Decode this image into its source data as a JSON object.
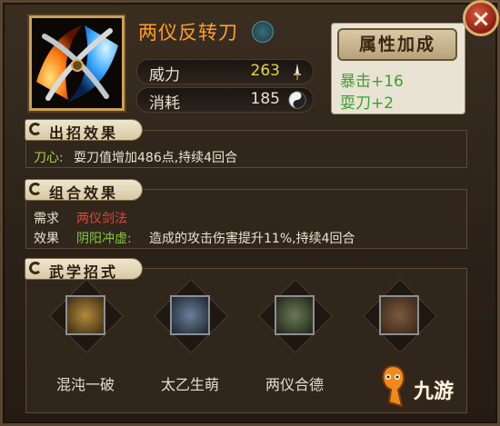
{
  "close": {
    "label": "×"
  },
  "skill": {
    "name": "两仪反转刀",
    "power_label": "威力",
    "power_value": "263",
    "cost_label": "消耗",
    "cost_value": "185"
  },
  "attributes": {
    "button_label": "属性加成",
    "lines": [
      "暴击+16",
      "耍刀+2"
    ]
  },
  "effect": {
    "title": "出招效果",
    "tag": "刀心:",
    "text": "耍刀值增加486点,持续4回合"
  },
  "combo": {
    "title": "组合效果",
    "requirement_label": "需求",
    "requirement_value": "两仪剑法",
    "effect_label": "效果",
    "effect_name": "阴阳冲虚:",
    "effect_text": "造成的攻击伤害提升11%,持续4回合"
  },
  "moves": {
    "title": "武学招式",
    "items": [
      "混沌一破",
      "太乙生萌",
      "两仪合德",
      ""
    ]
  },
  "watermark": {
    "text": "九游"
  },
  "colors": {
    "skill_name": "#ff9d2a",
    "power_value": "#e6d34a",
    "cost_value": "#e8dfcf",
    "attr_green": "#3f9d32",
    "effect_tag": "#a8d44a",
    "requirement_red": "#e0463a",
    "combo_green": "#86c93f"
  },
  "icons": {
    "close": "close-icon",
    "skill": "crossed-blades-fire-ice-icon",
    "feather": "feather-icon",
    "power": "sword-icon",
    "cost": "yin-yang-icon"
  }
}
